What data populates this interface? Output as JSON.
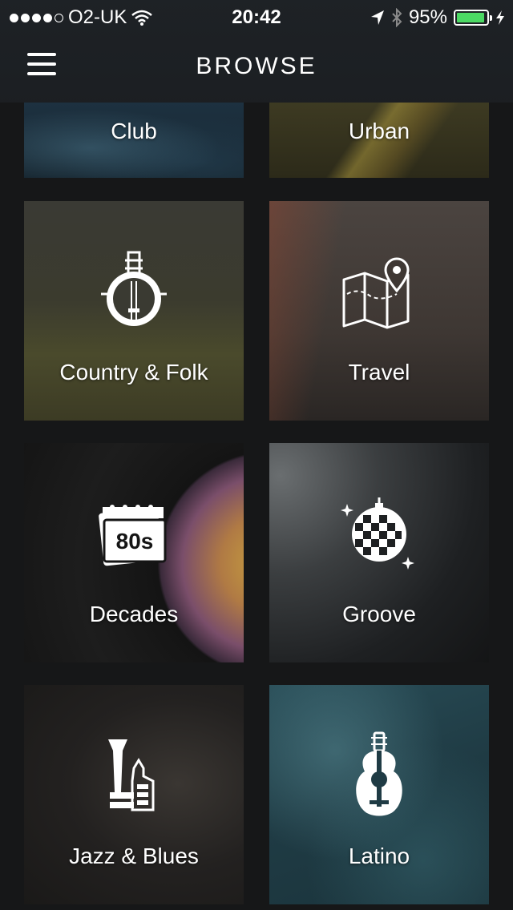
{
  "status_bar": {
    "carrier": "O2-UK",
    "time": "20:42",
    "battery_percent": "95%",
    "battery_level": 0.95,
    "battery_color": "#4cd964",
    "icons": [
      "signal-dots",
      "wifi-icon",
      "location-arrow-icon",
      "bluetooth-icon",
      "battery-icon",
      "charging-bolt-icon"
    ]
  },
  "nav": {
    "title": "BROWSE",
    "menu_icon": "hamburger-icon"
  },
  "categories": [
    {
      "label": "Club",
      "icon": null
    },
    {
      "label": "Urban",
      "icon": null
    },
    {
      "label": "Country & Folk",
      "icon": "banjo-icon"
    },
    {
      "label": "Travel",
      "icon": "map-pin-icon"
    },
    {
      "label": "Decades",
      "icon": "calendar-80s-icon",
      "icon_text": "80s"
    },
    {
      "label": "Groove",
      "icon": "disco-ball-icon"
    },
    {
      "label": "Jazz & Blues",
      "icon": "trumpet-icon"
    },
    {
      "label": "Latino",
      "icon": "guitar-icon"
    }
  ]
}
